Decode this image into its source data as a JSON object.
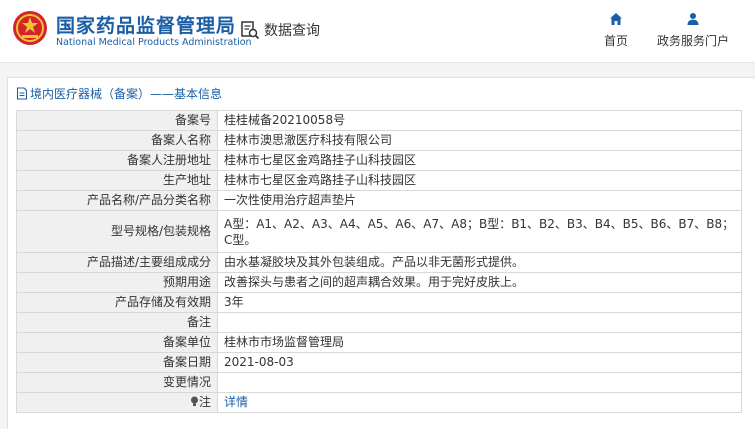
{
  "header": {
    "brand_cn": "国家药品监督管理局",
    "brand_en": "National Medical Products Administration",
    "query_label": "数据查询",
    "nav": [
      {
        "label": "首页",
        "icon": "home-icon"
      },
      {
        "label": "政务服务门户",
        "icon": "user-icon"
      }
    ]
  },
  "breadcrumb": "境内医疗器械（备案）——基本信息",
  "colors": {
    "accent": "#1a5fa6",
    "label_bg": "#f0f0f0",
    "emblem_red": "#d4242b",
    "emblem_gold": "#f2c230"
  },
  "table": {
    "rows": [
      {
        "label": "备案号",
        "value": "桂桂械备20210058号"
      },
      {
        "label": "备案人名称",
        "value": "桂林市澳思澈医疗科技有限公司"
      },
      {
        "label": "备案人注册地址",
        "value": "桂林市七星区金鸡路挂子山科技园区"
      },
      {
        "label": "生产地址",
        "value": "桂林市七星区金鸡路挂子山科技园区"
      },
      {
        "label": "产品名称/产品分类名称",
        "value": "一次性使用治疗超声垫片"
      },
      {
        "label": "型号规格/包装规格",
        "value": "A型：A1、A2、A3、A4、A5、A6、A7、A8；B型：B1、B2、B3、B4、B5、B6、B7、B8；C型。"
      },
      {
        "label": "产品描述/主要组成成分",
        "value": "由水基凝胶块及其外包装组成。产品以非无菌形式提供。"
      },
      {
        "label": "预期用途",
        "value": "改善探头与患者之间的超声耦合效果。用于完好皮肤上。"
      },
      {
        "label": "产品存储及有效期",
        "value": "3年"
      },
      {
        "label": "备注",
        "value": ""
      },
      {
        "label": "备案单位",
        "value": "桂林市市场监督管理局"
      },
      {
        "label": "备案日期",
        "value": "2021-08-03"
      },
      {
        "label": "变更情况",
        "value": ""
      },
      {
        "label": "注",
        "value": "详情"
      }
    ]
  }
}
